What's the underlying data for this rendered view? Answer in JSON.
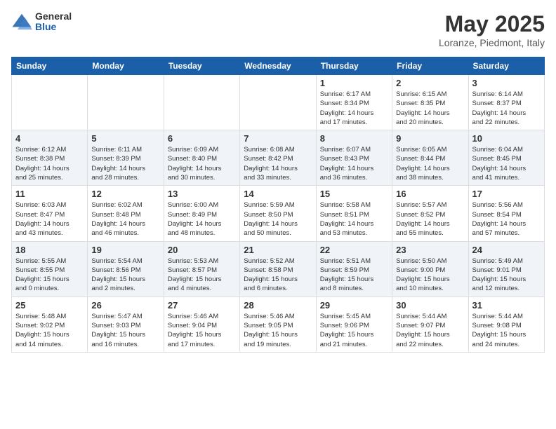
{
  "header": {
    "logo_general": "General",
    "logo_blue": "Blue",
    "month_title": "May 2025",
    "subtitle": "Loranze, Piedmont, Italy"
  },
  "calendar": {
    "days_of_week": [
      "Sunday",
      "Monday",
      "Tuesday",
      "Wednesday",
      "Thursday",
      "Friday",
      "Saturday"
    ],
    "weeks": [
      [
        {
          "day": "",
          "info": ""
        },
        {
          "day": "",
          "info": ""
        },
        {
          "day": "",
          "info": ""
        },
        {
          "day": "",
          "info": ""
        },
        {
          "day": "1",
          "info": "Sunrise: 6:17 AM\nSunset: 8:34 PM\nDaylight: 14 hours\nand 17 minutes."
        },
        {
          "day": "2",
          "info": "Sunrise: 6:15 AM\nSunset: 8:35 PM\nDaylight: 14 hours\nand 20 minutes."
        },
        {
          "day": "3",
          "info": "Sunrise: 6:14 AM\nSunset: 8:37 PM\nDaylight: 14 hours\nand 22 minutes."
        }
      ],
      [
        {
          "day": "4",
          "info": "Sunrise: 6:12 AM\nSunset: 8:38 PM\nDaylight: 14 hours\nand 25 minutes."
        },
        {
          "day": "5",
          "info": "Sunrise: 6:11 AM\nSunset: 8:39 PM\nDaylight: 14 hours\nand 28 minutes."
        },
        {
          "day": "6",
          "info": "Sunrise: 6:09 AM\nSunset: 8:40 PM\nDaylight: 14 hours\nand 30 minutes."
        },
        {
          "day": "7",
          "info": "Sunrise: 6:08 AM\nSunset: 8:42 PM\nDaylight: 14 hours\nand 33 minutes."
        },
        {
          "day": "8",
          "info": "Sunrise: 6:07 AM\nSunset: 8:43 PM\nDaylight: 14 hours\nand 36 minutes."
        },
        {
          "day": "9",
          "info": "Sunrise: 6:05 AM\nSunset: 8:44 PM\nDaylight: 14 hours\nand 38 minutes."
        },
        {
          "day": "10",
          "info": "Sunrise: 6:04 AM\nSunset: 8:45 PM\nDaylight: 14 hours\nand 41 minutes."
        }
      ],
      [
        {
          "day": "11",
          "info": "Sunrise: 6:03 AM\nSunset: 8:47 PM\nDaylight: 14 hours\nand 43 minutes."
        },
        {
          "day": "12",
          "info": "Sunrise: 6:02 AM\nSunset: 8:48 PM\nDaylight: 14 hours\nand 46 minutes."
        },
        {
          "day": "13",
          "info": "Sunrise: 6:00 AM\nSunset: 8:49 PM\nDaylight: 14 hours\nand 48 minutes."
        },
        {
          "day": "14",
          "info": "Sunrise: 5:59 AM\nSunset: 8:50 PM\nDaylight: 14 hours\nand 50 minutes."
        },
        {
          "day": "15",
          "info": "Sunrise: 5:58 AM\nSunset: 8:51 PM\nDaylight: 14 hours\nand 53 minutes."
        },
        {
          "day": "16",
          "info": "Sunrise: 5:57 AM\nSunset: 8:52 PM\nDaylight: 14 hours\nand 55 minutes."
        },
        {
          "day": "17",
          "info": "Sunrise: 5:56 AM\nSunset: 8:54 PM\nDaylight: 14 hours\nand 57 minutes."
        }
      ],
      [
        {
          "day": "18",
          "info": "Sunrise: 5:55 AM\nSunset: 8:55 PM\nDaylight: 15 hours\nand 0 minutes."
        },
        {
          "day": "19",
          "info": "Sunrise: 5:54 AM\nSunset: 8:56 PM\nDaylight: 15 hours\nand 2 minutes."
        },
        {
          "day": "20",
          "info": "Sunrise: 5:53 AM\nSunset: 8:57 PM\nDaylight: 15 hours\nand 4 minutes."
        },
        {
          "day": "21",
          "info": "Sunrise: 5:52 AM\nSunset: 8:58 PM\nDaylight: 15 hours\nand 6 minutes."
        },
        {
          "day": "22",
          "info": "Sunrise: 5:51 AM\nSunset: 8:59 PM\nDaylight: 15 hours\nand 8 minutes."
        },
        {
          "day": "23",
          "info": "Sunrise: 5:50 AM\nSunset: 9:00 PM\nDaylight: 15 hours\nand 10 minutes."
        },
        {
          "day": "24",
          "info": "Sunrise: 5:49 AM\nSunset: 9:01 PM\nDaylight: 15 hours\nand 12 minutes."
        }
      ],
      [
        {
          "day": "25",
          "info": "Sunrise: 5:48 AM\nSunset: 9:02 PM\nDaylight: 15 hours\nand 14 minutes."
        },
        {
          "day": "26",
          "info": "Sunrise: 5:47 AM\nSunset: 9:03 PM\nDaylight: 15 hours\nand 16 minutes."
        },
        {
          "day": "27",
          "info": "Sunrise: 5:46 AM\nSunset: 9:04 PM\nDaylight: 15 hours\nand 17 minutes."
        },
        {
          "day": "28",
          "info": "Sunrise: 5:46 AM\nSunset: 9:05 PM\nDaylight: 15 hours\nand 19 minutes."
        },
        {
          "day": "29",
          "info": "Sunrise: 5:45 AM\nSunset: 9:06 PM\nDaylight: 15 hours\nand 21 minutes."
        },
        {
          "day": "30",
          "info": "Sunrise: 5:44 AM\nSunset: 9:07 PM\nDaylight: 15 hours\nand 22 minutes."
        },
        {
          "day": "31",
          "info": "Sunrise: 5:44 AM\nSunset: 9:08 PM\nDaylight: 15 hours\nand 24 minutes."
        }
      ]
    ]
  }
}
